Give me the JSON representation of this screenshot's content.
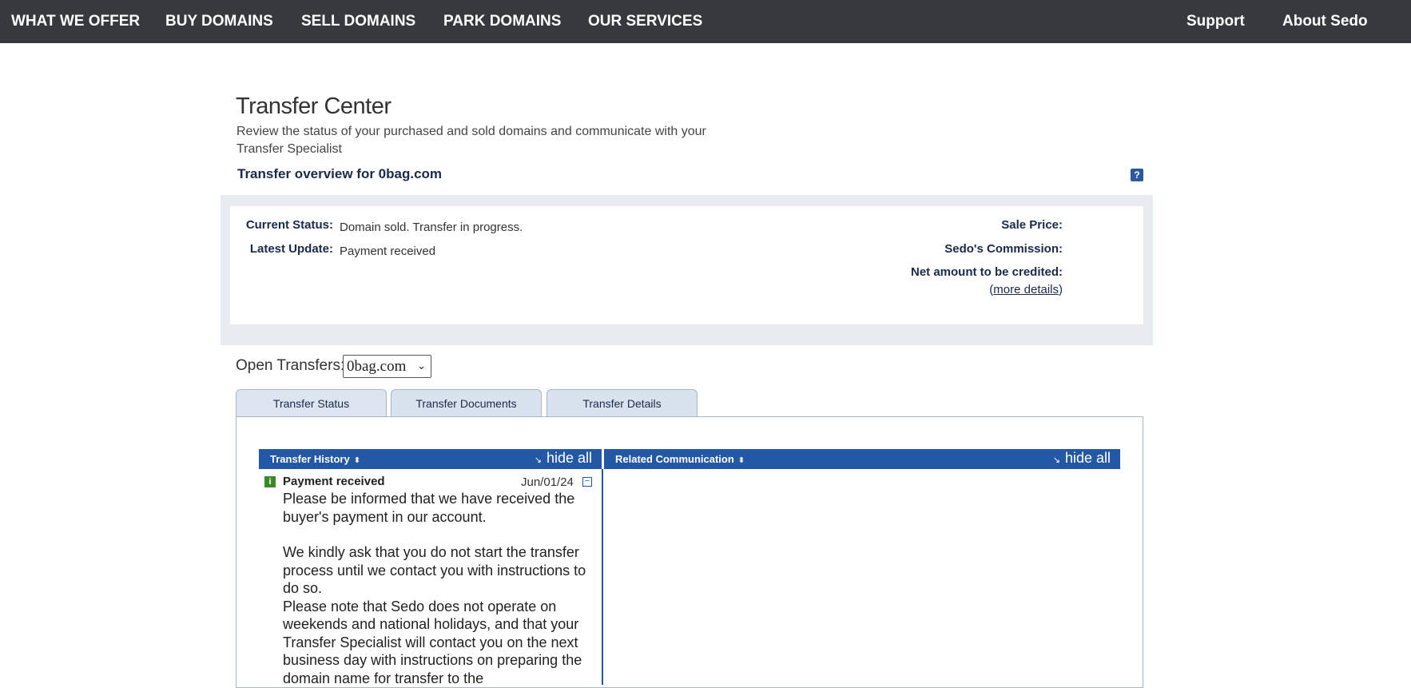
{
  "nav": {
    "left": [
      "WHAT WE OFFER",
      "BUY DOMAINS",
      "SELL DOMAINS",
      "PARK DOMAINS",
      "OUR SERVICES"
    ],
    "right": [
      "Support",
      "About Sedo"
    ]
  },
  "header": {
    "title": "Transfer Center",
    "subtitle": "Review the status of your purchased and sold domains and communicate with your Transfer Specialist",
    "overview_title": "Transfer overview for 0bag.com",
    "help_icon": "?"
  },
  "summary": {
    "current_status_label": "Current Status:",
    "current_status_value": "Domain sold. Transfer in progress.",
    "latest_update_label": "Latest Update:",
    "latest_update_value": "Payment received",
    "sale_price_label": "Sale Price:",
    "commission_label": "Sedo's Commission:",
    "net_amount_label": "Net amount to be credited:",
    "more_details_open": "(",
    "more_details_link": "more details",
    "more_details_close": ")"
  },
  "open_transfers": {
    "label": "Open Transfers:",
    "selected": "0bag.com"
  },
  "tabs": [
    "Transfer Status",
    "Transfer Documents",
    "Transfer Details"
  ],
  "history": {
    "title": "Transfer History",
    "hide_all": "hide all",
    "entries": [
      {
        "title": "Payment received",
        "date": "Jun/01/24",
        "icon": "info-icon",
        "p1": "Please be informed that we have received the buyer's payment in our account.",
        "p2": "We kindly ask that you do not start the transfer process until we contact you with instructions to do so.",
        "p3": "Please note that Sedo does not operate on weekends and national holidays, and that your Transfer Specialist will contact you on the next business day with instructions on preparing the domain name for transfer to the"
      }
    ]
  },
  "communication": {
    "title": "Related Communication",
    "hide_all": "hide all"
  },
  "colors": {
    "nav_bg": "#363a3f",
    "bar_blue": "#2358a6",
    "summary_bg": "#e8ecf0",
    "tab_bg": "#d9e2ef"
  }
}
